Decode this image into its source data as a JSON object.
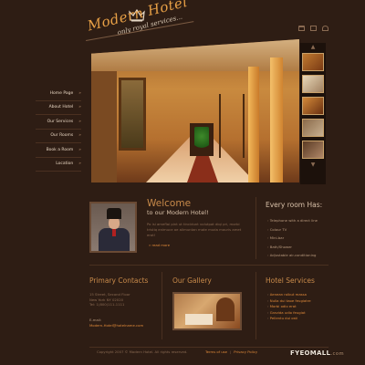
{
  "header": {
    "logo_title": "Modern Hotel",
    "logo_tagline": "only royal services...",
    "icons": [
      "home-icon",
      "mail-icon",
      "sitemap-icon"
    ]
  },
  "nav": {
    "items": [
      {
        "label": "Home Page"
      },
      {
        "label": "About Hotel"
      },
      {
        "label": "Our Services"
      },
      {
        "label": "Our Rooms"
      },
      {
        "label": "Book a Room"
      },
      {
        "label": "Location"
      }
    ],
    "arrow": "»"
  },
  "gallery_strip": {
    "up": "▲",
    "down": "▼"
  },
  "welcome": {
    "title": "Welcome",
    "subtitle": "to our Modern Hotel!",
    "body": "Po isi ameflai pint ut tincidunt volutpat diqi pri, morbi tristiq enimuce ae alimuntan mate muda mauris amet erat!",
    "read_more": "» read more"
  },
  "rooms": {
    "title": "Every room Has:",
    "items": [
      "Telephone with a direct line",
      "Colour TV",
      "Mini-bar",
      "Bath/Shower",
      "Adjustable air-conditioning"
    ]
  },
  "contacts": {
    "title": "Primary Contacts",
    "lines": [
      "15 Street, Second Floor",
      "New York NY 02020",
      "Tel: 1(800)111-1111"
    ],
    "email_label": "E-mail:",
    "email": "Modern-Hotel@hotelname.com"
  },
  "gallery": {
    "title": "Our Gallery"
  },
  "services": {
    "title": "Hotel Services",
    "items": [
      "Aenean rolbut massa",
      "Nulla dui taoe feugiatre",
      "Morbi odio erat",
      "Gravida udio feugiat",
      "Pellentu dui osti"
    ]
  },
  "footer": {
    "copyright": "Copyright 2007 © Modern Hotel. All rights reserved.",
    "terms": "Terms of use",
    "privacy": "Privacy Policy",
    "divider": "|"
  },
  "watermark": {
    "main": "FYEOMALL",
    "suffix": ".com"
  },
  "colors": {
    "background": "#2e1d14",
    "accent": "#e08a3a",
    "heading": "#c88a4a",
    "text": "#b99a7e"
  }
}
